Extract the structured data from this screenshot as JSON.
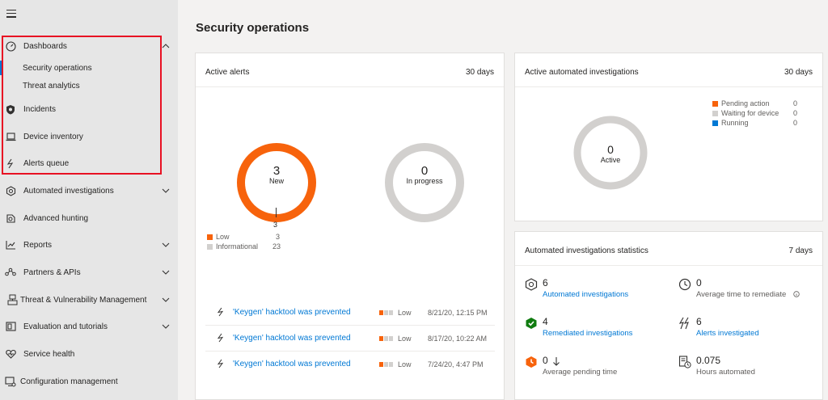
{
  "sidebar": {
    "menu_icon": "hamburger-icon",
    "items": [
      {
        "label": "Dashboards",
        "icon": "gauge-icon"
      },
      {
        "label": "Incidents",
        "icon": "shield-icon"
      },
      {
        "label": "Device inventory",
        "icon": "laptop-icon"
      },
      {
        "label": "Alerts queue",
        "icon": "bolt-icon"
      },
      {
        "label": "Automated investigations",
        "icon": "cycle-icon"
      },
      {
        "label": "Advanced hunting",
        "icon": "hunt-icon"
      },
      {
        "label": "Reports",
        "icon": "chart-icon"
      },
      {
        "label": "Partners & APIs",
        "icon": "nodes-icon"
      },
      {
        "label": "Threat & Vulnerability Management",
        "icon": "threat-icon"
      },
      {
        "label": "Evaluation and tutorials",
        "icon": "eval-icon"
      },
      {
        "label": "Service health",
        "icon": "heart-icon"
      },
      {
        "label": "Configuration management",
        "icon": "config-icon"
      }
    ],
    "dashboard_subitems": [
      "Security operations",
      "Threat analytics"
    ]
  },
  "page": {
    "title": "Security operations"
  },
  "active_alerts": {
    "title": "Active alerts",
    "days": "30 days",
    "new_count": "3",
    "new_label": "New",
    "inprogress_count": "0",
    "inprogress_label": "In progress",
    "tick_value": "3",
    "legend": [
      {
        "label": "Low",
        "value": "3",
        "color": "#f7630c"
      },
      {
        "label": "Informational",
        "value": "23",
        "color": "#d2d0ce"
      }
    ],
    "alerts": [
      {
        "title": "'Keygen' hacktool was prevented",
        "severity": "Low",
        "date": "8/21/20, 12:15 PM"
      },
      {
        "title": "'Keygen' hacktool was prevented",
        "severity": "Low",
        "date": "8/17/20, 10:22 AM"
      },
      {
        "title": "'Keygen' hacktool was prevented",
        "severity": "Low",
        "date": "7/24/20, 4:47 PM"
      }
    ]
  },
  "active_investigations": {
    "title": "Active automated investigations",
    "days": "30 days",
    "count": "0",
    "label": "Active",
    "legend": [
      {
        "label": "Pending action",
        "value": "0",
        "color": "#f7630c"
      },
      {
        "label": "Waiting for device",
        "value": "0",
        "color": "#d2d0ce"
      },
      {
        "label": "Running",
        "value": "0",
        "color": "#0078d4"
      }
    ]
  },
  "investigation_stats": {
    "title": "Automated investigations statistics",
    "days": "7 days",
    "stats": [
      {
        "value": "6",
        "label": "Automated investigations",
        "icon": "hexagon-icon"
      },
      {
        "value": "0",
        "label": "Average time to remediate",
        "icon": "clock-icon"
      },
      {
        "value": "4",
        "label": "Remediated investigations",
        "icon": "remediated-hexagon-icon"
      },
      {
        "value": "6",
        "label": "Alerts investigated",
        "icon": "double-bolt-icon"
      },
      {
        "value": "0",
        "label": "Average pending time",
        "icon": "pending-hexagon-icon"
      },
      {
        "value": "0.075",
        "label": "Hours automated",
        "icon": "document-clock-icon"
      }
    ]
  },
  "colors": {
    "accent": "#0078d4",
    "orange": "#f7630c",
    "gray_ring": "#d2d0ce",
    "highlight_border": "#e81123"
  }
}
